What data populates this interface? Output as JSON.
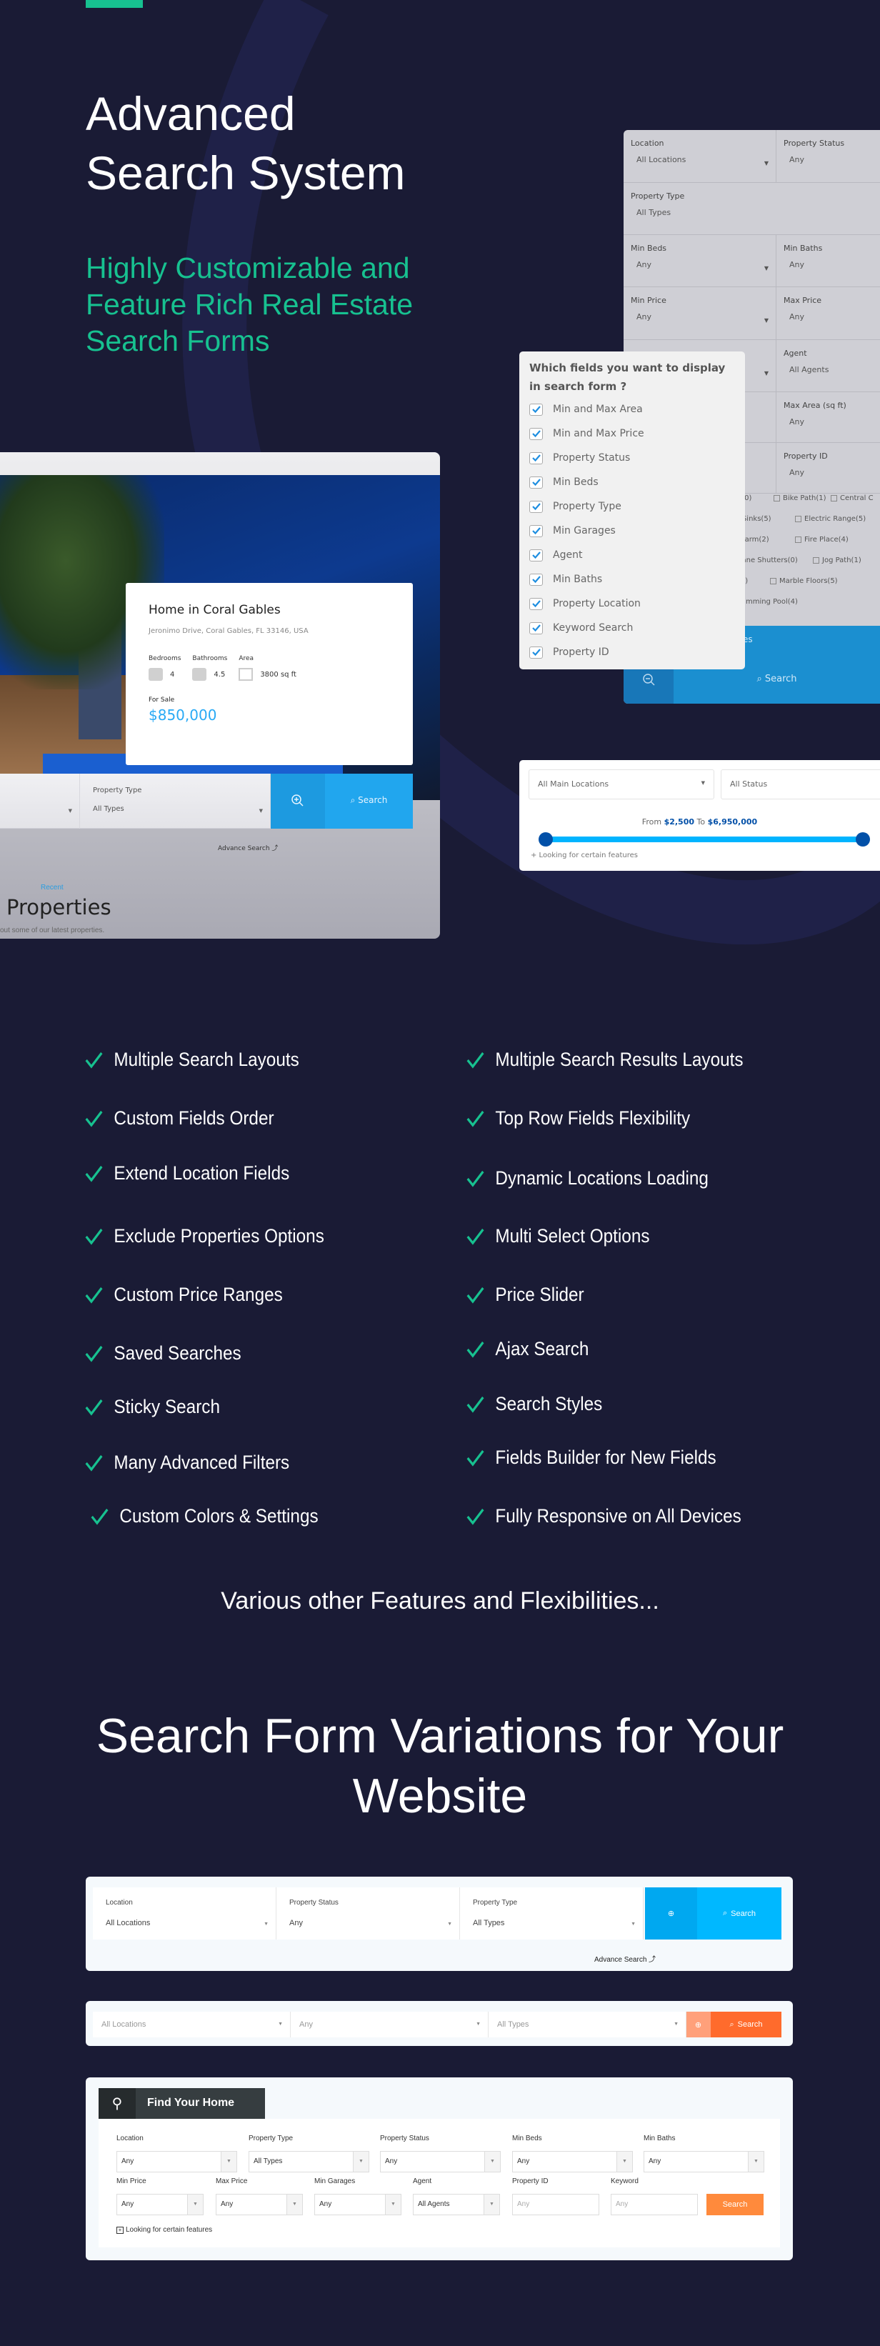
{
  "hero": {
    "title_line1": "Advanced",
    "title_line2": "Search System",
    "subtitle_line1": "Highly Customizable and",
    "subtitle_line2": "Feature Rich Real Estate",
    "subtitle_line3": "Search Forms"
  },
  "colors": {
    "background": "#1a1b35",
    "accent_green": "#17c190",
    "blue_button": "#21a6ee",
    "orange_button": "#ff6b2c"
  },
  "advanced_panel": {
    "fields": [
      {
        "label": "Location",
        "value": "All Locations"
      },
      {
        "label": "Property Status",
        "value": "Any"
      },
      {
        "label": "Property Type",
        "value": "All Types"
      },
      {
        "label": "Min Beds",
        "value": "Any"
      },
      {
        "label": "Min Baths",
        "value": "Any"
      },
      {
        "label": "Min Price",
        "value": "Any"
      },
      {
        "label": "Max Price",
        "value": "Any"
      },
      {
        "label": "Agent",
        "value": "All Agents"
      },
      {
        "label": "Max Area (sq ft)",
        "value": "Any"
      },
      {
        "label": "Property ID",
        "value": "Any"
      }
    ],
    "amenities": [
      "s(0)",
      "Bike Path(1)",
      "Central C",
      "l Sinks(5)",
      "Electric Range(5)",
      "Alarm(2)",
      "Fire Place(4)",
      "cane Shutters(0)",
      "Jog Path(1)",
      "(5)",
      "Marble Floors(5)",
      "wimming Pool(4)"
    ],
    "features_label": "tures",
    "search_label": "Search"
  },
  "fields_popup": {
    "title": "Which fields you want to display in search form ?",
    "options": [
      "Min and Max Area",
      "Min and Max Price",
      "Property Status",
      "Min Beds",
      "Property Type",
      "Min Garages",
      "Agent",
      "Min Baths",
      "Property Location",
      "Keyword Search",
      "Property ID"
    ]
  },
  "property_card": {
    "title": "Home in Coral Gables",
    "address": "Jeronimo Drive, Coral Gables, FL 33146, USA",
    "specs": [
      {
        "label": "Bedrooms",
        "value": "4",
        "icon": "bed-icon"
      },
      {
        "label": "Bathrooms",
        "value": "4.5",
        "icon": "shower-icon"
      },
      {
        "label": "Area",
        "value": "3800 sq ft",
        "icon": "area-icon"
      }
    ],
    "status": "For Sale",
    "price": "$850,000",
    "search_bar": {
      "type_label": "Property Type",
      "type_value": "All Types",
      "search_label": "Search"
    },
    "advance_search_note": "Advance Search",
    "recent_label": "Recent",
    "section_title": "Properties",
    "section_sub": "out some of our latest properties."
  },
  "slider_form": {
    "location": "All Main Locations",
    "status": "All Status",
    "from_label": "From",
    "min": "$2,500",
    "to_label": "To",
    "max": "$6,950,000",
    "features_link": "+ Looking for certain features"
  },
  "features": {
    "left": [
      "Multiple Search Layouts",
      "Custom Fields Order",
      "Extend Location Fields",
      "Exclude Properties Options",
      "Custom Price Ranges",
      "Saved Searches",
      "Sticky Search",
      "Many Advanced Filters",
      "Custom Colors & Settings"
    ],
    "right": [
      "Multiple Search Results Layouts",
      "Top Row Fields Flexibility",
      "Dynamic Locations Loading",
      "Multi Select Options",
      "Price Slider",
      "Ajax Search",
      "Search Styles",
      "Fields Builder for New Fields",
      "Fully Responsive on All Devices"
    ],
    "more": "Various other Features and Flexibilities..."
  },
  "variations": {
    "title_line1": "Search Form Variations for Your",
    "title_line2": "Website",
    "form1": {
      "fields": [
        {
          "label": "Location",
          "value": "All Locations"
        },
        {
          "label": "Property Status",
          "value": "Any"
        },
        {
          "label": "Property Type",
          "value": "All Types"
        }
      ],
      "search_label": "Search",
      "note": "Advance Search"
    },
    "form2": {
      "fields": [
        "All Locations",
        "Any",
        "All Types"
      ],
      "search_label": "Search"
    },
    "form3": {
      "header": "Find Your Home",
      "row1": [
        {
          "label": "Location",
          "value": "Any"
        },
        {
          "label": "Property Type",
          "value": "All Types"
        },
        {
          "label": "Property Status",
          "value": "Any"
        },
        {
          "label": "Min Beds",
          "value": "Any"
        },
        {
          "label": "Min Baths",
          "value": "Any"
        }
      ],
      "row2": [
        {
          "label": "Min Price",
          "value": "Any"
        },
        {
          "label": "Max Price",
          "value": "Any"
        },
        {
          "label": "Min Garages",
          "value": "Any"
        },
        {
          "label": "Agent",
          "value": "All Agents"
        }
      ],
      "inputs": [
        {
          "label": "Property ID",
          "placeholder": "Any"
        },
        {
          "label": "Keyword",
          "placeholder": "Any"
        }
      ],
      "search_label": "Search",
      "features_link": "Looking for certain features"
    }
  }
}
